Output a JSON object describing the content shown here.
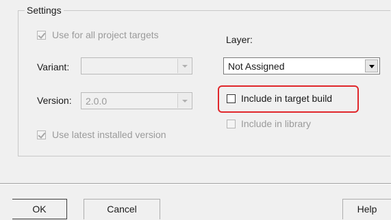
{
  "settings": {
    "group_label": "Settings",
    "use_for_all_targets": {
      "label": "Use for all project targets",
      "checked": true,
      "enabled": false
    },
    "variant": {
      "label": "Variant:",
      "value": ""
    },
    "version": {
      "label": "Version:",
      "value": "2.0.0"
    },
    "use_latest_installed": {
      "label": "Use latest installed version",
      "checked": true,
      "enabled": false
    },
    "layer": {
      "label": "Layer:",
      "value": "Not Assigned"
    },
    "include_in_target_build": {
      "label": "Include in target build",
      "checked": false,
      "enabled": true
    },
    "include_in_library": {
      "label": "Include in library",
      "checked": false,
      "enabled": false
    }
  },
  "buttons": {
    "ok": "OK",
    "cancel": "Cancel",
    "help": "Help"
  },
  "colors": {
    "highlight": "#e0262a",
    "disabled_text": "#9a9a9a"
  }
}
